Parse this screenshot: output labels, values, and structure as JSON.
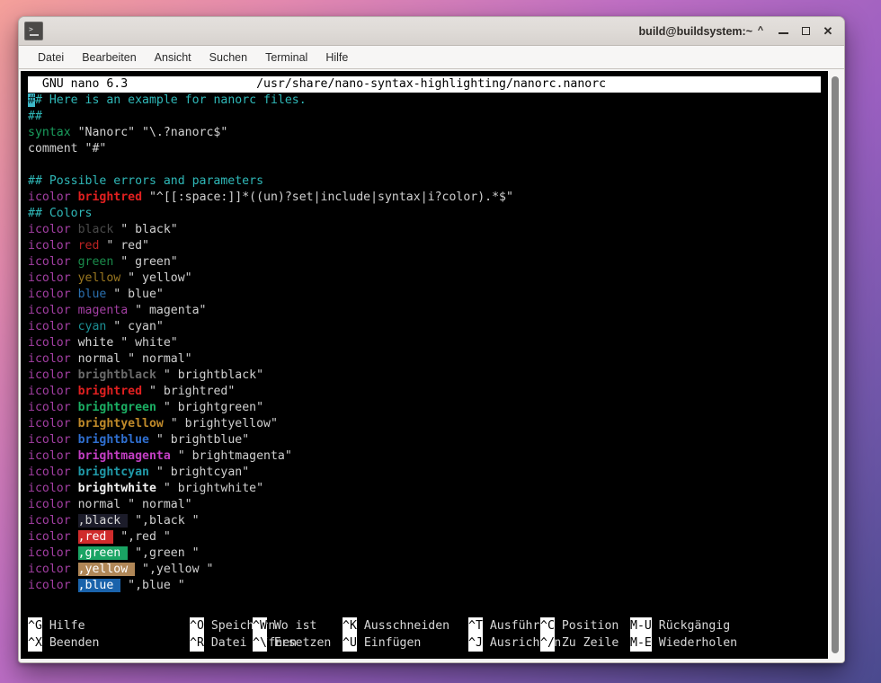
{
  "desktop": {
    "bg_start": "#f4a09a",
    "bg_end": "#4a4a8e"
  },
  "window": {
    "title": "build@buildsystem:~",
    "icon": "terminal-icon",
    "controls": {
      "shade": "^",
      "minimize": "_",
      "maximize": "□",
      "close": "✕"
    }
  },
  "menubar": {
    "items": [
      {
        "label": "Datei"
      },
      {
        "label": "Bearbeiten"
      },
      {
        "label": "Ansicht"
      },
      {
        "label": "Suchen"
      },
      {
        "label": "Terminal"
      },
      {
        "label": "Hilfe"
      }
    ]
  },
  "nano": {
    "version_label": "GNU nano 6.3",
    "file_path": "/usr/share/nano-syntax-highlighting/nanorc.nanorc",
    "titlebar_text": "  GNU nano 6.3                  /usr/share/nano-syntax-highlighting/nanorc.nanorc",
    "cursor_char": "#",
    "lines": [
      {
        "id": 1,
        "text": "## Here is an example for nanorc files.",
        "kind": "comment-cursor"
      },
      {
        "id": 2,
        "text": "##",
        "kind": "comment"
      },
      {
        "id": 3,
        "text": "syntax \"Nanorc\" \"\\.?nanorc$\"",
        "kind": "syntax"
      },
      {
        "id": 4,
        "text": "comment \"#\"",
        "kind": "plain"
      },
      {
        "id": 5,
        "text": "",
        "kind": "blank"
      },
      {
        "id": 6,
        "text": "## Possible errors and parameters",
        "kind": "comment"
      },
      {
        "id": 7,
        "text": "icolor brightred \"^[[:space:]]*((un)?set|include|syntax|i?color).*$\"",
        "kind": "icolor-regex",
        "color": "brightred"
      },
      {
        "id": 8,
        "text": "## Colors",
        "kind": "comment"
      },
      {
        "id": 9,
        "text": "icolor black \" black\"",
        "kind": "icolor",
        "color": "black",
        "arg": "\" black\""
      },
      {
        "id": 10,
        "text": "icolor red \" red\"",
        "kind": "icolor",
        "color": "red",
        "arg": "\" red\""
      },
      {
        "id": 11,
        "text": "icolor green \" green\"",
        "kind": "icolor",
        "color": "green",
        "arg": "\" green\""
      },
      {
        "id": 12,
        "text": "icolor yellow \" yellow\"",
        "kind": "icolor",
        "color": "yellow",
        "arg": "\" yellow\""
      },
      {
        "id": 13,
        "text": "icolor blue \" blue\"",
        "kind": "icolor",
        "color": "blue",
        "arg": "\" blue\""
      },
      {
        "id": 14,
        "text": "icolor magenta \" magenta\"",
        "kind": "icolor",
        "color": "magenta",
        "arg": "\" magenta\""
      },
      {
        "id": 15,
        "text": "icolor cyan \" cyan\"",
        "kind": "icolor",
        "color": "cyan",
        "arg": "\" cyan\""
      },
      {
        "id": 16,
        "text": "icolor white \" white\"",
        "kind": "icolor",
        "color": "white",
        "arg": "\" white\""
      },
      {
        "id": 17,
        "text": "icolor normal \" normal\"",
        "kind": "icolor",
        "color": "normal",
        "arg": "\" normal\""
      },
      {
        "id": 18,
        "text": "icolor brightblack \" brightblack\"",
        "kind": "icolor",
        "color": "brightblack",
        "arg": "\" brightblack\""
      },
      {
        "id": 19,
        "text": "icolor brightred \" brightred\"",
        "kind": "icolor",
        "color": "brightred",
        "arg": "\" brightred\""
      },
      {
        "id": 20,
        "text": "icolor brightgreen \" brightgreen\"",
        "kind": "icolor",
        "color": "brightgreen",
        "arg": "\" brightgreen\""
      },
      {
        "id": 21,
        "text": "icolor brightyellow \" brightyellow\"",
        "kind": "icolor",
        "color": "brightyellow",
        "arg": "\" brightyellow\""
      },
      {
        "id": 22,
        "text": "icolor brightblue \" brightblue\"",
        "kind": "icolor",
        "color": "brightblue",
        "arg": "\" brightblue\""
      },
      {
        "id": 23,
        "text": "icolor brightmagenta \" brightmagenta\"",
        "kind": "icolor",
        "color": "brightmagenta",
        "arg": "\" brightmagenta\""
      },
      {
        "id": 24,
        "text": "icolor brightcyan \" brightcyan\"",
        "kind": "icolor",
        "color": "brightcyan",
        "arg": "\" brightcyan\""
      },
      {
        "id": 25,
        "text": "icolor brightwhite \" brightwhite\"",
        "kind": "icolor",
        "color": "brightwhite",
        "arg": "\" brightwhite\""
      },
      {
        "id": 26,
        "text": "icolor normal \" normal\"",
        "kind": "icolor",
        "color": "normal",
        "arg": "\" normal\""
      },
      {
        "id": 27,
        "text": "icolor ,black \",black \"",
        "kind": "icolor-bg",
        "color": ",black ",
        "arg": "\",black \""
      },
      {
        "id": 28,
        "text": "icolor ,red \",red \"",
        "kind": "icolor-bg",
        "color": ",red ",
        "arg": "\",red \""
      },
      {
        "id": 29,
        "text": "icolor ,green \",green \"",
        "kind": "icolor-bg",
        "color": ",green ",
        "arg": "\",green \""
      },
      {
        "id": 30,
        "text": "icolor ,yellow \",yellow \"",
        "kind": "icolor-bg",
        "color": ",yellow ",
        "arg": "\",yellow \""
      },
      {
        "id": 31,
        "text": "icolor ,blue \",blue \"",
        "kind": "icolor-bg",
        "color": ",blue ",
        "arg": "\",blue \""
      }
    ],
    "help": {
      "row1": [
        {
          "key": "^G",
          "label": "Hilfe"
        },
        {
          "key": "^O",
          "label": "Speichern"
        },
        {
          "key": "^W",
          "label": "Wo ist"
        },
        {
          "key": "^K",
          "label": "Ausschneiden"
        },
        {
          "key": "^T",
          "label": "Ausführen"
        },
        {
          "key": "^C",
          "label": "Position"
        },
        {
          "key": "M-U",
          "label": "Rückgängig"
        }
      ],
      "row2": [
        {
          "key": "^X",
          "label": "Beenden"
        },
        {
          "key": "^R",
          "label": "Datei öffnen"
        },
        {
          "key": "^\\",
          "label": "Ersetzen"
        },
        {
          "key": "^U",
          "label": "Einfügen"
        },
        {
          "key": "^J",
          "label": "Ausrichten"
        },
        {
          "key": "^/",
          "label": "Zu Zeile"
        },
        {
          "key": "M-E",
          "label": "Wiederholen"
        }
      ]
    }
  }
}
